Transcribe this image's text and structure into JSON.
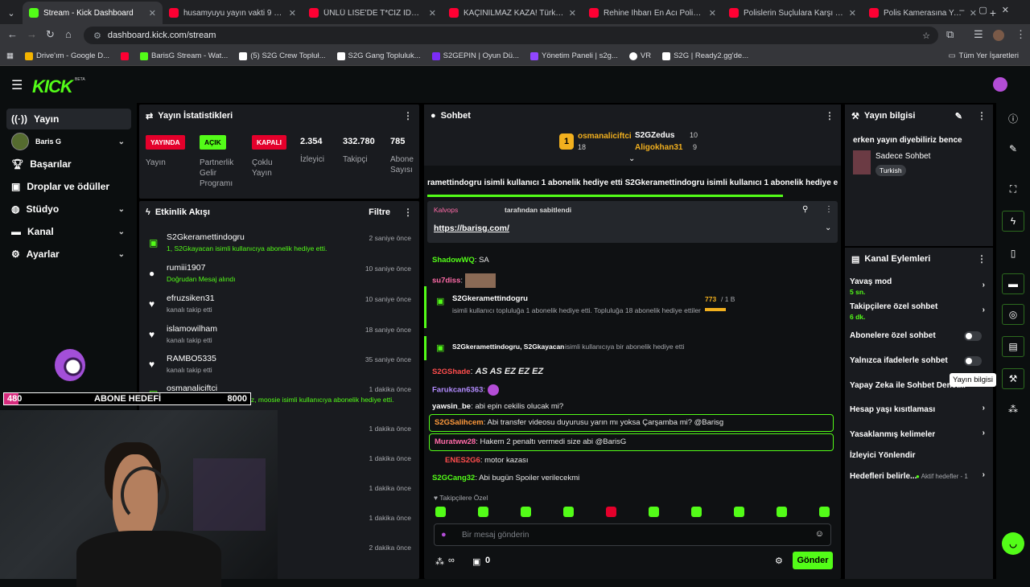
{
  "browser": {
    "tabs": [
      {
        "title": "Stream - Kick Dashboard",
        "color": "#53fc18",
        "active": true
      },
      {
        "title": "husamyuyu yayın vakti 9 - YouT",
        "color": "#ff0033"
      },
      {
        "title": "ÜNLÜ LİSE'DE T*CİZ İDDİASI -",
        "color": "#ff0033"
      },
      {
        "title": "KAÇINILMAZ KAZA! Türkiye'de",
        "color": "#ff0033"
      },
      {
        "title": "Rehine İhbarı En Acı Polis Kova",
        "color": "#ff0033"
      },
      {
        "title": "Polislerin Suçlulara Karşı Yenild",
        "color": "#ff0033"
      },
      {
        "title": "Polis Kamerasına Yakalanan 6 D",
        "color": "#ff0033"
      }
    ],
    "url": "dashboard.kick.com/stream",
    "bookmarks": [
      {
        "label": "Drive'ım - Google D...",
        "color": "#f4b400"
      },
      {
        "label": "BarisG Stream - Wat...",
        "color": "#ff0033"
      },
      {
        "label": "(5) S2G Crew Topluł...",
        "color": "#ffffff"
      },
      {
        "label": "S2G Gang Topluluk...",
        "color": "#ffffff"
      },
      {
        "label": "S2GEPIN | Oyun Dü...",
        "color": "#7b2cf5"
      },
      {
        "label": "Yönetim Paneli | s2g...",
        "color": "#9146ff"
      },
      {
        "label": "VR",
        "color": "#ffffff"
      },
      {
        "label": "S2G | Ready2.gg'de...",
        "color": "#ffffff"
      }
    ],
    "all_bookmarks": "Tüm Yer İşaretleri"
  },
  "kick": {
    "logo": "KICK",
    "beta": "BETA",
    "sidebar": {
      "items": [
        {
          "label": "Yayın",
          "icon": "broadcast-icon"
        },
        {
          "label": "Baris G",
          "icon": "avatar"
        },
        {
          "label": "Başarılar",
          "icon": "trophy-icon"
        },
        {
          "label": "Droplar ve ödüller",
          "icon": "gift-icon"
        },
        {
          "label": "Stüdyo",
          "icon": "studio-icon"
        },
        {
          "label": "Kanal",
          "icon": "channel-icon"
        },
        {
          "label": "Ayarlar",
          "icon": "gear-icon"
        }
      ]
    },
    "stats": {
      "title": "Yayın İstatistikleri",
      "status_live": "YAYINDA",
      "status_live_label": "Yayın",
      "partner_badge": "AÇIK",
      "partner_label": "Partnerlik Gelir Programı",
      "multi_badge": "KAPALI",
      "multi_label": "Çoklu Yayın",
      "viewers": "2.354",
      "viewers_label": "İzleyici",
      "followers": "332.780",
      "followers_label": "Takipçi",
      "subs": "785",
      "subs_label": "Abone Sayısı"
    },
    "activity": {
      "title": "Etkinlik Akışı",
      "filter": "Filtre",
      "events": [
        {
          "name": "S2Gkeramettindogru",
          "sub": "1, S2Gkayacan isimli kullanıcıya abonelik hediye etti.",
          "time": "2 saniye önce",
          "icon": "gift-icon"
        },
        {
          "name": "rumiii1907",
          "sub": "Doğrudan Mesaj alındı",
          "time": "10 saniye önce",
          "icon": "message-icon"
        },
        {
          "name": "efruzsiken31",
          "sub": "kanalı takip etti",
          "time": "10 saniye önce",
          "icon": "heart-icon"
        },
        {
          "name": "islamowilham",
          "sub": "kanalı takip etti",
          "time": "18 saniye önce",
          "icon": "heart-icon"
        },
        {
          "name": "RAMBO5335",
          "sub": "kanalı takip etti",
          "time": "35 saniye önce",
          "icon": "heart-icon"
        },
        {
          "name": "osmanaliciftci",
          "sub": "5, japatavel, equlp, ... arquez, moosie isimli kullanıcıya abonelik hediye etti.",
          "time": "1 dakika önce",
          "icon": "gift-icon"
        }
      ],
      "extra_times": [
        "1 dakika önce",
        "1 dakika önce",
        "1 dakika önce",
        "1 dakika önce",
        "2 dakika önce"
      ]
    },
    "overlay": {
      "goal_count": "480",
      "goal_label": "ABONE HEDEFİ",
      "goal_target": "8000"
    },
    "chat": {
      "title": "Sohbet",
      "top_gifters": [
        {
          "name": "osmanaliciftci",
          "count": "18"
        },
        {
          "name": "S2GZedus",
          "count": "10"
        },
        {
          "name": "Aligokhan31",
          "count": "9"
        }
      ],
      "rank": "1",
      "ticker": "ramettindogru isimli kullanıcı 1 abonelik hediye etti   S2Gkeramettindogru isimli kullanıcı 1 abonelik hediye etti",
      "pinned_by": "Kalvops",
      "pinned_suffix": "tarafından sabitlendi",
      "pinned_link": "https://barisg.com/",
      "messages": [
        {
          "user": "ShadowWQ",
          "text": "SA",
          "color": "#53fc18"
        },
        {
          "user": "su7diss",
          "text": "",
          "color": "#ff6ba8"
        }
      ],
      "gift_big": {
        "user": "S2Gkeramettindogru",
        "text": "isimli kullanıcı topluluğa 1 abonelik hediye etti. Topluluğa 18 abonelik hediye ettiler",
        "progress": "773",
        "progress_total": "/ 1 B"
      },
      "gift_small": {
        "users": "S2Gkeramettindogru, S2Gkayacan",
        "text": "isimli kullanıcıya bir abonelik hediye etti"
      },
      "lines": [
        {
          "user": "S2GShade",
          "text": "AS AS EZ EZ EZ",
          "color": "#ff4d4d"
        },
        {
          "user": "Farukcan6363",
          "text": "",
          "color": "#b38cff"
        },
        {
          "user": "yawsin_be",
          "text": "abi epin cekilis olucak mi?",
          "color": "#ffffff"
        },
        {
          "user": "S2GSalihcem",
          "text": "Abi transfer videosu duyurusu yarın mı yoksa Çarşamba mi? @Barisg",
          "color": "#ff9a3c"
        },
        {
          "user": "Muratww28",
          "text": "Hakem 2 penaltı vermedi size abi @BarisG",
          "color": "#ff6ba8"
        },
        {
          "user": "ENES2G6",
          "text": "motor kazası",
          "color": "#ff4d4d"
        },
        {
          "user": "S2GCang32",
          "text": "Abi bugün Spoiler verilecekmi",
          "color": "#53fc18"
        }
      ],
      "followers_only": "Takipçilere Özel",
      "input_placeholder": "Bir mesaj gönderin",
      "send": "Gönder",
      "footer_count": "0",
      "infinity": "∞"
    },
    "stream_info": {
      "title": "Yayın bilgisi",
      "stream_title": "erken yayın diyebiliriz bence",
      "category": "Sadece Sohbet",
      "language": "Turkish"
    },
    "channel_actions": {
      "title": "Kanal Eylemleri",
      "items": [
        {
          "label": "Yavaş mod",
          "sub": "5 sn."
        },
        {
          "label": "Takipçilere özel sohbet",
          "sub": "6 dk."
        },
        {
          "label": "Abonelere özel sohbet",
          "sub": ""
        },
        {
          "label": "Yalnızca ifadelerle sohbet",
          "sub": ""
        },
        {
          "label": "Yapay Zeka ile Sohbet Denet...",
          "sub": ""
        },
        {
          "label": "Hesap yaşı kısıtlaması",
          "sub": ""
        },
        {
          "label": "Yasaklanmış kelimeler",
          "sub": ""
        },
        {
          "label": "İzleyici Yönlendir",
          "sub": ""
        },
        {
          "label": "Hedefleri belirle...",
          "sub": ""
        }
      ],
      "goals_active": "Aktif hedefler - 1",
      "tooltip": "Yayın bilgisi"
    },
    "colors": {
      "brand": "#53fc18",
      "live": "#e4002b",
      "panel": "#191b1f"
    }
  }
}
